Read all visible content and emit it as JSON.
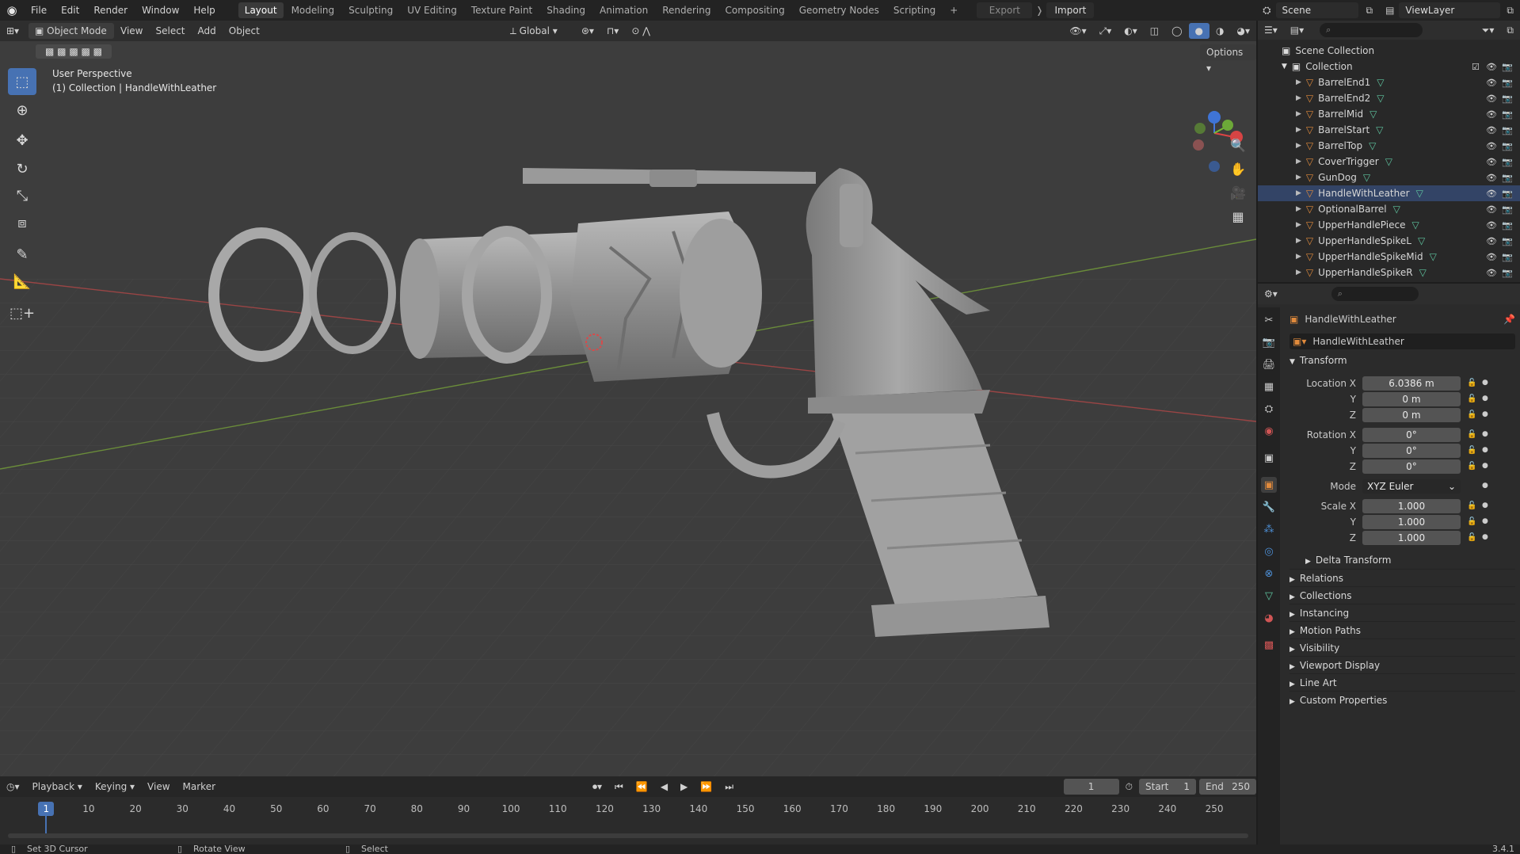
{
  "topbar": {
    "menus": [
      "File",
      "Edit",
      "Render",
      "Window",
      "Help"
    ],
    "workspaces": [
      "Layout",
      "Modeling",
      "Sculpting",
      "UV Editing",
      "Texture Paint",
      "Shading",
      "Animation",
      "Rendering",
      "Compositing",
      "Geometry Nodes",
      "Scripting"
    ],
    "active_workspace": "Layout",
    "add_tab": "+",
    "export_label": "Export",
    "import_label": "Import",
    "scene": "Scene",
    "view_layer": "ViewLayer"
  },
  "viewport_header": {
    "mode": "Object Mode",
    "menus": [
      "View",
      "Select",
      "Add",
      "Object"
    ],
    "orientation": "Global",
    "options": "Options"
  },
  "viewport": {
    "perspective_label": "User Perspective",
    "context_label": "(1) Collection | HandleWithLeather",
    "gizmo_axes": [
      "X",
      "Y",
      "Z"
    ]
  },
  "outliner": {
    "scene_collection": "Scene Collection",
    "collection": "Collection",
    "items": [
      "BarrelEnd1",
      "BarrelEnd2",
      "BarrelMid",
      "BarrelStart",
      "BarrelTop",
      "CoverTrigger",
      "GunDog",
      "HandleWithLeather",
      "OptionalBarrel",
      "UpperHandlePiece",
      "UpperHandleSpikeL",
      "UpperHandleSpikeMid",
      "UpperHandleSpikeR"
    ],
    "selected": "HandleWithLeather"
  },
  "properties": {
    "object_name": "HandleWithLeather",
    "object_field": "HandleWithLeather",
    "transform_label": "Transform",
    "location_label": "Location X",
    "rotation_label": "Rotation X",
    "scale_label": "Scale X",
    "y_label": "Y",
    "z_label": "Z",
    "mode_label": "Mode",
    "location": [
      "6.0386 m",
      "0 m",
      "0 m"
    ],
    "rotation": [
      "0°",
      "0°",
      "0°"
    ],
    "rotation_mode": "XYZ Euler",
    "scale": [
      "1.000",
      "1.000",
      "1.000"
    ],
    "delta_transform": "Delta Transform",
    "panels": [
      "Relations",
      "Collections",
      "Instancing",
      "Motion Paths",
      "Visibility",
      "Viewport Display",
      "Line Art",
      "Custom Properties"
    ]
  },
  "timeline": {
    "menus": [
      "Playback",
      "Keying",
      "View",
      "Marker"
    ],
    "current_frame": "1",
    "start_label": "Start",
    "start": "1",
    "end_label": "End",
    "end": "250",
    "frame_marks": [
      "1",
      "10",
      "20",
      "30",
      "40",
      "50",
      "60",
      "70",
      "80",
      "90",
      "100",
      "110",
      "120",
      "130",
      "140",
      "150",
      "160",
      "170",
      "180",
      "190",
      "200",
      "210",
      "220",
      "230",
      "240",
      "250"
    ]
  },
  "statusbar": {
    "hints": [
      "Set 3D Cursor",
      "Rotate View",
      "Select"
    ],
    "version": "3.4.1"
  }
}
